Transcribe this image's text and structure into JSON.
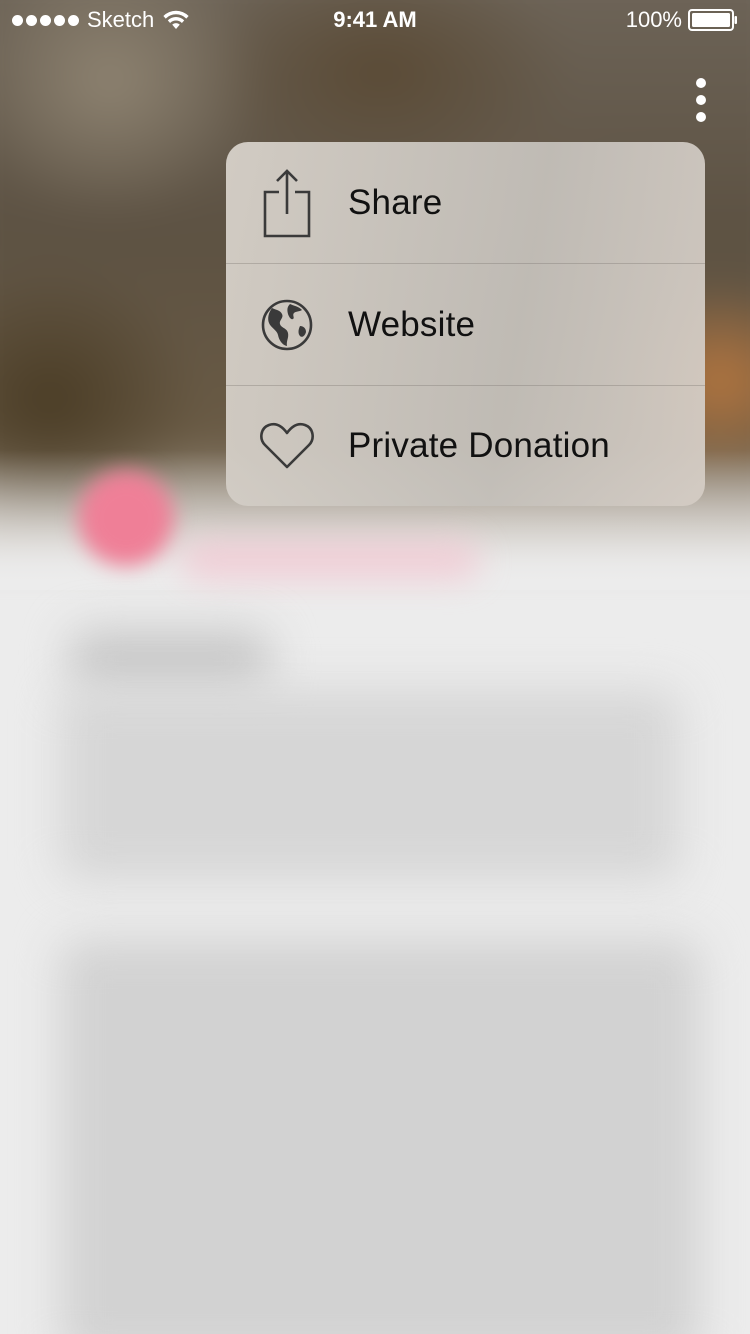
{
  "status_bar": {
    "carrier": "Sketch",
    "time": "9:41 AM",
    "battery": "100%"
  },
  "menu": {
    "items": [
      {
        "label": "Share",
        "icon": "share-icon"
      },
      {
        "label": "Website",
        "icon": "globe-icon"
      },
      {
        "label": "Private Donation",
        "icon": "heart-icon"
      }
    ]
  },
  "colors": {
    "menu_text": "#111111",
    "icon_stroke": "#3a3a3a",
    "avatar_pink": "#ef7f97"
  }
}
